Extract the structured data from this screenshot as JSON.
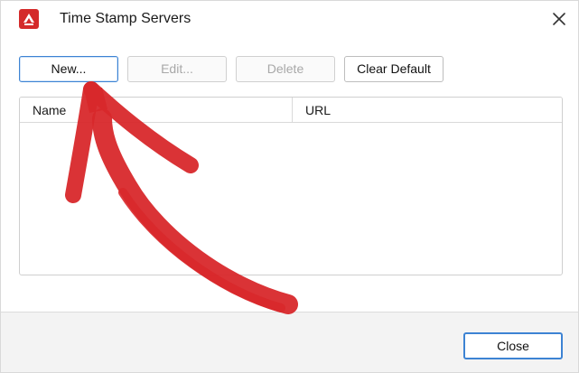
{
  "window": {
    "title": "Time Stamp Servers",
    "app_icon": "pdf-app-icon",
    "close_icon": "close-icon"
  },
  "toolbar": {
    "new_label": "New...",
    "edit_label": "Edit...",
    "delete_label": "Delete",
    "clear_default_label": "Clear Default"
  },
  "table": {
    "columns": [
      "Name",
      "URL"
    ],
    "rows": []
  },
  "footer": {
    "close_label": "Close"
  },
  "annotation": {
    "type": "red-hand-drawn-arrow",
    "color": "#d8282b",
    "points_to": "new-button"
  },
  "colors": {
    "accent": "#3d83d3",
    "brand_red": "#d42a2a"
  }
}
